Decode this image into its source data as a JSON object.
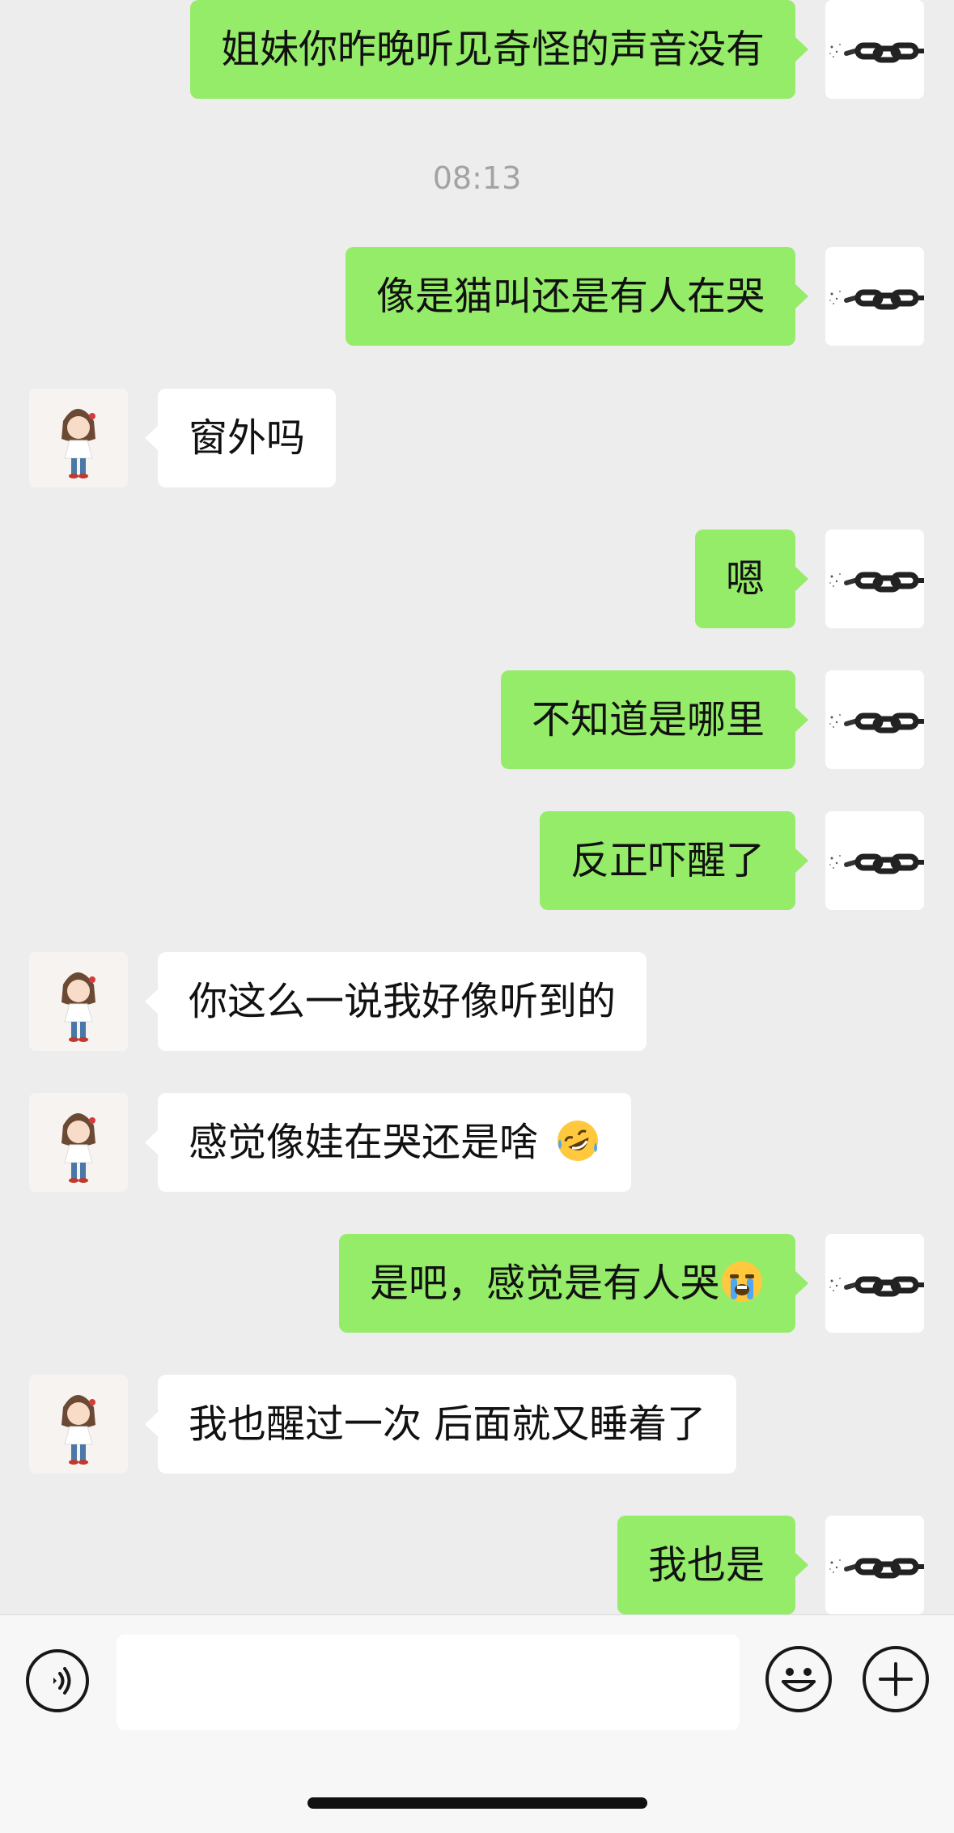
{
  "timestamp": "08:13",
  "messages": [
    {
      "side": "me",
      "text": "姐妹你昨晚听见奇怪的声音没有"
    },
    {
      "side": "me",
      "text": "像是猫叫还是有人在哭"
    },
    {
      "side": "other",
      "text": "窗外吗"
    },
    {
      "side": "me",
      "text": "嗯"
    },
    {
      "side": "me",
      "text": "不知道是哪里"
    },
    {
      "side": "me",
      "text": "反正吓醒了"
    },
    {
      "side": "other",
      "text": "你这么一说我好像听到的"
    },
    {
      "side": "other",
      "text": "感觉像娃在哭还是啥",
      "emoji": "rolling-laughing-emoji"
    },
    {
      "side": "me",
      "text": "是吧，感觉是有人哭",
      "emoji": "crying-emoji"
    },
    {
      "side": "other",
      "text": "我也醒过一次 后面就又睡着了"
    },
    {
      "side": "me",
      "text": "我也是"
    }
  ],
  "input": {
    "placeholder": ""
  },
  "icons": {
    "voice": "voice-icon",
    "emoji": "emoji-face-icon",
    "plus": "plus-icon",
    "me_avatar": "chain-link-avatar",
    "other_avatar": "cartoon-girl-avatar"
  },
  "colors": {
    "me_bubble": "#95EC69",
    "other_bubble": "#FFFFFF",
    "background": "#EDEDED"
  }
}
